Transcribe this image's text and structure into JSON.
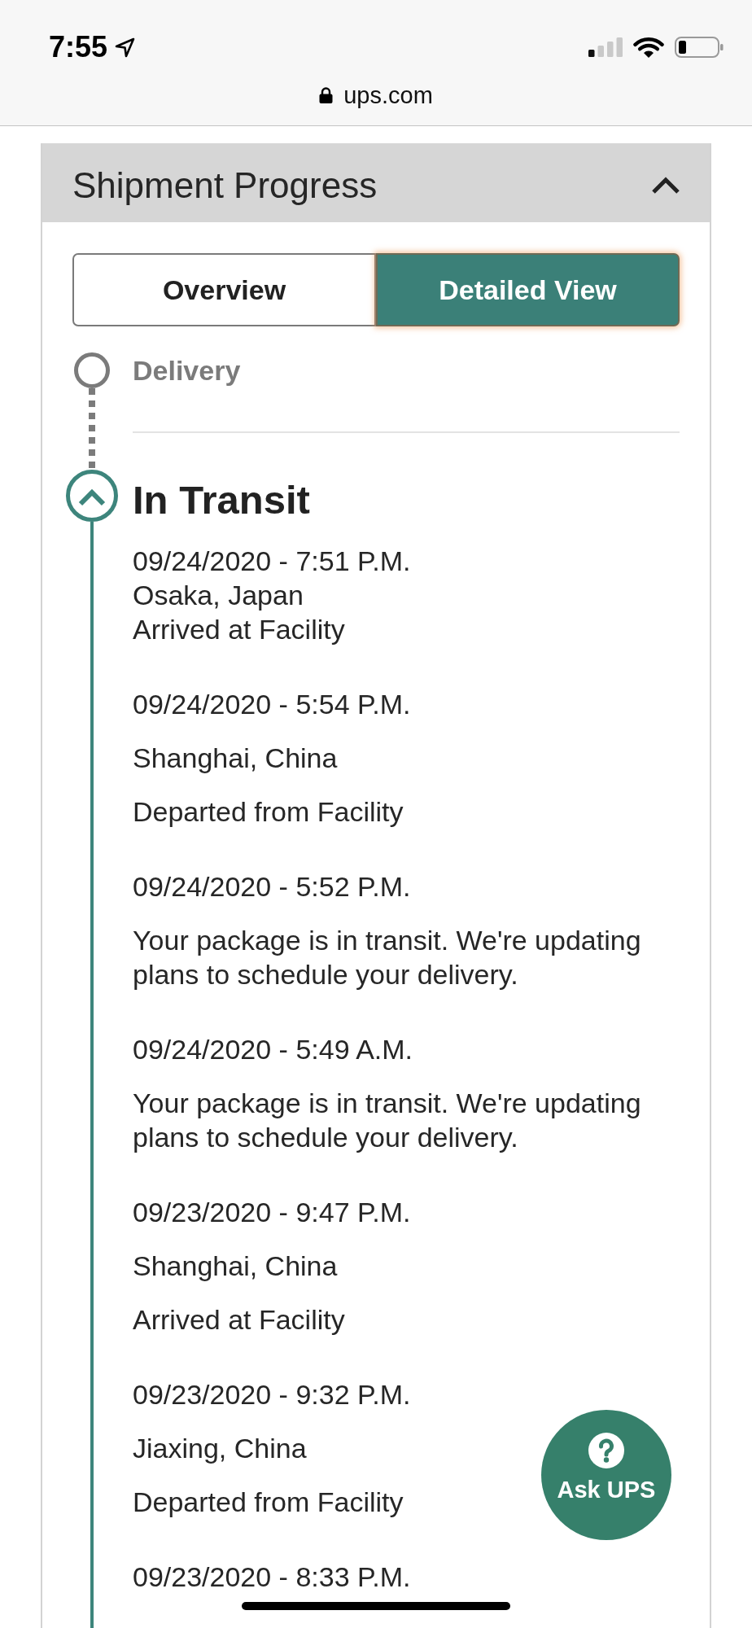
{
  "status_bar": {
    "time": "7:55"
  },
  "address_bar": {
    "url": "ups.com"
  },
  "shipment_progress": {
    "title": "Shipment Progress",
    "expanded": true,
    "tabs": [
      {
        "label": "Overview",
        "selected": false
      },
      {
        "label": "Detailed View",
        "selected": true
      }
    ],
    "stages": [
      {
        "label": "Delivery",
        "kind": "pending",
        "expanded": false
      },
      {
        "label": "In Transit",
        "kind": "current",
        "expanded": true,
        "events": [
          {
            "kind": "compact",
            "date": "09/24/2020 - 7:51 P.M.",
            "location": "Osaka, Japan",
            "activity": "Arrived at Facility"
          },
          {
            "kind": "spaced",
            "date": "09/24/2020 - 5:54 P.M.",
            "location": "Shanghai, China",
            "activity": "Departed from Facility"
          },
          {
            "kind": "spaced",
            "date": "09/24/2020 - 5:52 P.M.",
            "activity": "Your package is in transit. We're updating plans to schedule your delivery."
          },
          {
            "kind": "spaced",
            "date": "09/24/2020 - 5:49 A.M.",
            "activity": "Your package is in transit. We're updating plans to schedule your delivery."
          },
          {
            "kind": "spaced",
            "date": "09/23/2020 - 9:47 P.M.",
            "location": "Shanghai, China",
            "activity": "Arrived at Facility"
          },
          {
            "kind": "spaced",
            "date": "09/23/2020 - 9:32 P.M.",
            "location": "Jiaxing, China",
            "activity": "Departed from Facility"
          },
          {
            "kind": "spaced",
            "date": "09/23/2020 - 8:33 P.M."
          }
        ]
      }
    ]
  },
  "ask_ups": {
    "label": "Ask UPS"
  }
}
